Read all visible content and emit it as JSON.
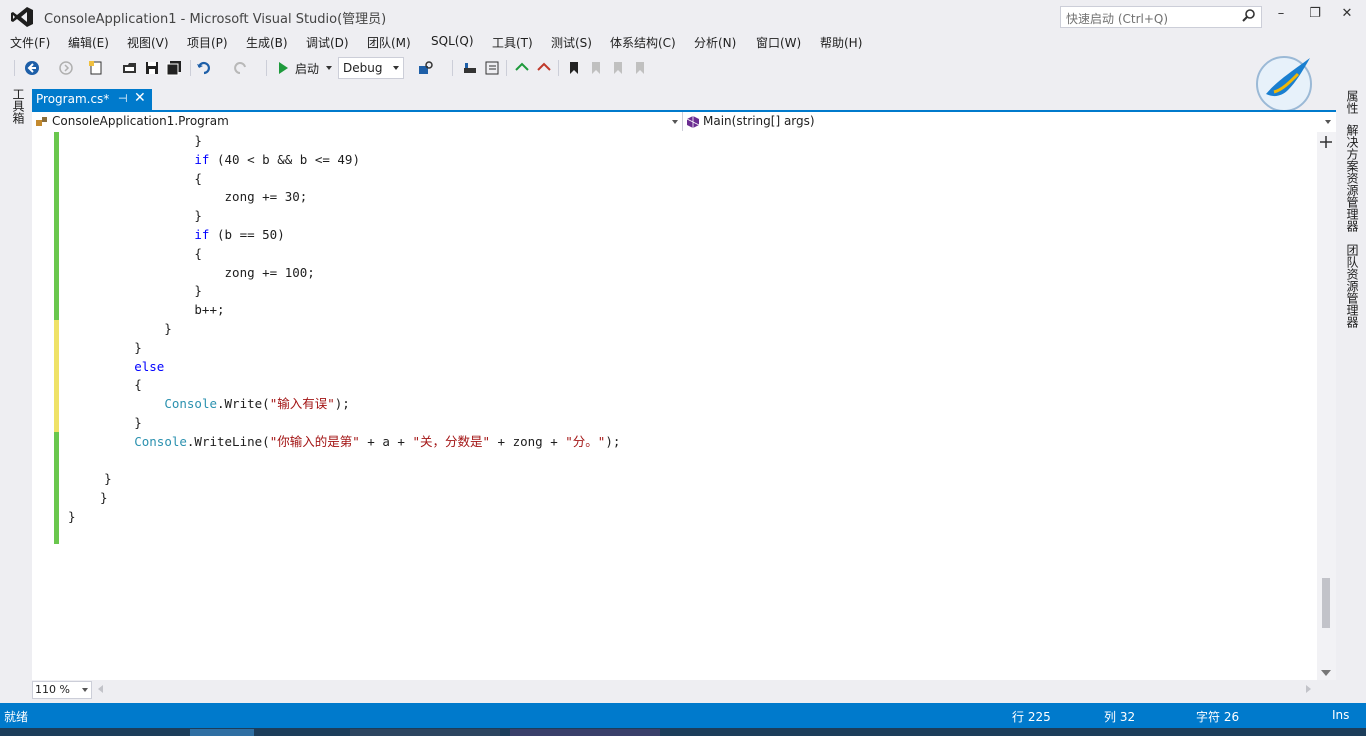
{
  "window": {
    "title": "ConsoleApplication1 - Microsoft Visual Studio(管理员)",
    "quick_launch_placeholder": "快速启动 (Ctrl+Q)",
    "minimize_label": "–",
    "restore_label": "❐",
    "close_label": "✕"
  },
  "menu": {
    "items": [
      "文件(F)",
      "编辑(E)",
      "视图(V)",
      "项目(P)",
      "生成(B)",
      "调试(D)",
      "团队(M)",
      "SQL(Q)",
      "工具(T)",
      "测试(S)",
      "体系结构(C)",
      "分析(N)",
      "窗口(W)",
      "帮助(H)"
    ]
  },
  "toolbar": {
    "start_label": "启动",
    "config_value": "Debug"
  },
  "left_strip": {
    "toolbox_label": "工具箱"
  },
  "right_strip": {
    "properties_label": "属性",
    "solution_explorer_label": "解决方案资源管理器",
    "team_explorer_label": "团队资源管理器"
  },
  "tab": {
    "name": "Program.cs*"
  },
  "nav": {
    "class_value": "ConsoleApplication1.Program",
    "member_value": "Main(string[] args)"
  },
  "code_lines": [
    "                }",
    "                if (40 < b && b <= 49)",
    "                {",
    "                    zong += 30;",
    "                }",
    "                if (b == 50)",
    "                {",
    "                    zong += 100;",
    "                }",
    "                b++;",
    "            }",
    "        }",
    "        else",
    "        {",
    "            Console.Write(\"输入有误\");",
    "        }",
    "        Console.WriteLine(\"你输入的是第\" + a + \"关，分数是\" + zong + \"分。\");",
    "",
    "    }",
    "}",
    "}"
  ],
  "editor": {
    "zoom": "110 %"
  },
  "status": {
    "ready": "就绪",
    "line": "行 225",
    "col": "列 32",
    "char": "字符 26",
    "mode": "Ins"
  },
  "colors": {
    "accent": "#007acc",
    "keyword": "#0000ff",
    "type": "#2b91af",
    "string": "#a31515",
    "change_saved": "#6ac74d",
    "change_unsaved": "#efe267"
  }
}
